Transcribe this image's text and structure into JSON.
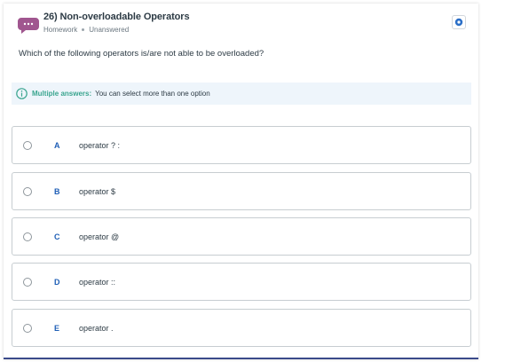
{
  "header": {
    "title": "26) Non-overloadable Operators",
    "category": "Homework",
    "status": "Unanswered",
    "icon": "chat-bubble-icon",
    "bookmark_icon": "bookmark-icon"
  },
  "question": {
    "text": "Which of the following operators is/are not able to be overloaded?"
  },
  "info": {
    "label": "Multiple answers:",
    "text": "You can select more than one option",
    "icon": "info-icon"
  },
  "options": [
    {
      "letter": "A",
      "text": "operator ? :"
    },
    {
      "letter": "B",
      "text": "operator $"
    },
    {
      "letter": "C",
      "text": "operator @"
    },
    {
      "letter": "D",
      "text": "operator ::"
    },
    {
      "letter": "E",
      "text": "operator ."
    }
  ],
  "colors": {
    "accent": "#1f5fb6",
    "info_label": "#3aa58f",
    "info_bg": "#eef5fb",
    "chat_icon": "#a0568f"
  }
}
